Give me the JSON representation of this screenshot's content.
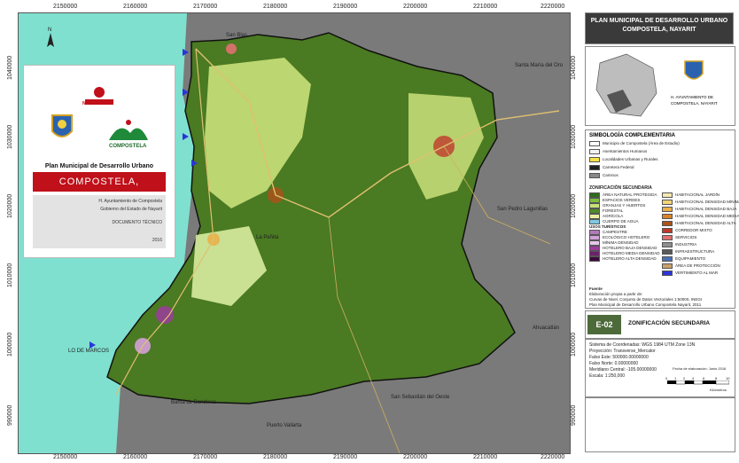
{
  "axes": {
    "top_ticks": [
      "2150000",
      "2160000",
      "2170000",
      "2180000",
      "2190000",
      "2200000",
      "2210000",
      "2220000"
    ],
    "bottom_ticks": [
      "2150000",
      "2160000",
      "2170000",
      "2180000",
      "2190000",
      "2200000",
      "2210000",
      "2220000"
    ],
    "left_ticks": [
      "1040000",
      "1030000",
      "1020000",
      "1010000",
      "1000000",
      "990000"
    ],
    "right_ticks": [
      "1040000",
      "1030000",
      "1020000",
      "1010000",
      "1000000",
      "990000"
    ]
  },
  "places": {
    "san_blas": "San Blas",
    "la_penita": "La Peñita",
    "lo_de_marcos": "LO DE MARCOS",
    "santa_maria": "Santa María del Oro",
    "san_pedro": "San Pedro Lagunillas",
    "san_sebastian": "San Sebastián del Oeste",
    "puerto_vallarta": "Puerto Vallarta",
    "bahia": "Bahía de Banderas",
    "ahuacatlan": "Ahuacatlán"
  },
  "inset": {
    "state": "NAYARIT",
    "municipality_logo": "COMPOSTELA",
    "plan_title": "Plan Municipal de Desarrollo Urbano",
    "town": "COMPOSTELA, NAYARIT.",
    "line1": "H. Ayuntamiento de Compostela",
    "line2": "Gobierno del Estado de Nayarit",
    "line3": "DOCUMENTO TÉCNICO",
    "year": "2016"
  },
  "title_panel": {
    "line1": "PLAN MUNICIPAL DE DESARROLLO URBANO",
    "line2": "COMPOSTELA, NAYARIT"
  },
  "locator": {
    "caption1": "H. AYUNTAMIENTO DE",
    "caption2": "COMPOSTELA, NAYARIT"
  },
  "legend": {
    "title": "SIMBOLOGÍA COMPLEMENTARIA",
    "complementary": [
      {
        "label": "Municipio de Compostela (Área de Estudio)",
        "color": "#ffffff"
      },
      {
        "label": "Asentamientos Humanos",
        "color": "#f2f2f2"
      },
      {
        "label": "Localidades Urbanas y Rurales",
        "color": "#f5e14a"
      },
      {
        "label": "Carretera Federal",
        "color": "#222222"
      },
      {
        "label": "Caminos",
        "color": "#888888"
      }
    ],
    "zoning_title": "ZONIFICACIÓN SECUNDARIA",
    "uses_title": "USOS TURÍSTICOS",
    "zoning": [
      {
        "label": "ÁREA NATURAL PROTEGIDA",
        "color": "#2f6b1f"
      },
      {
        "label": "ESPACIOS VERDES",
        "color": "#7fbf3f"
      },
      {
        "label": "GRANJAS Y HUERTOS",
        "color": "#c8e07a"
      },
      {
        "label": "FORESTAL",
        "color": "#4e8a2a"
      },
      {
        "label": "AGRÍCOLA",
        "color": "#e8f0a0"
      },
      {
        "label": "CUERPO DE AGUA",
        "color": "#7ec8e3"
      },
      {
        "label": "CAMPESTRE",
        "color": "#b07ab8"
      },
      {
        "label": "ECOLÓGICO HOTELERO",
        "color": "#d4a0d8"
      },
      {
        "label": "MÍNIMA DENSIDAD",
        "color": "#e6c6ea"
      },
      {
        "label": "HOTELERO BAJA DENSIDAD",
        "color": "#9b3c9b"
      },
      {
        "label": "HOTELERO MEDIA DENSIDAD",
        "color": "#6d1f6d"
      },
      {
        "label": "HOTELERO ALTA DENSIDAD",
        "color": "#3d0a3d"
      }
    ],
    "zoning_right": [
      {
        "label": "HABITACIONAL JARDÍN",
        "color": "#f6e8b0"
      },
      {
        "label": "HABITACIONAL DENSIDAD MÍNIMA",
        "color": "#f3d37a"
      },
      {
        "label": "HABITACIONAL DENSIDAD BAJA",
        "color": "#eab04a"
      },
      {
        "label": "HABITACIONAL DENSIDAD MEDIA",
        "color": "#d8842a"
      },
      {
        "label": "HABITACIONAL DENSIDAD ALTA",
        "color": "#a8541a"
      },
      {
        "label": "CORREDOR MIXTO",
        "color": "#c0392b"
      },
      {
        "label": "SERVICIOS",
        "color": "#e07070"
      },
      {
        "label": "INDUSTRIA",
        "color": "#8e8e8e"
      },
      {
        "label": "INFRAESTRUCTURA",
        "color": "#5a5a5a"
      },
      {
        "label": "EQUIPAMIENTO",
        "color": "#4a6fb0"
      },
      {
        "label": "ÁREA DE PROTECCIÓN",
        "color": "#c7a26a"
      },
      {
        "label": "VERTIMIENTO AL MAR",
        "color": "#2b35d8"
      }
    ],
    "source_title": "Fuente",
    "source1": "Elaboración propia a partir de:",
    "source2": "Curvas de Nivel, Conjunto de Datos Vectoriales 1:50000, INEGI",
    "source3": "Plan Municipal de Desarrollo Urbano Compostela Nayarit, 2011"
  },
  "plate": {
    "code": "E-02",
    "label": "ZONIFICACIÓN SECUNDARIA"
  },
  "info": {
    "l1": "Sistema de Coordenadas: WGS 1984 UTM Zone 13N",
    "l2": "Proyección: Transverse_Mercator",
    "l3": "Falso Este: 500000.00000000",
    "l4": "Falso Norte: 0.00000000",
    "l5": "Meridiano Central: -105.00000000",
    "l6": "Escala: 1:250,000",
    "date": "Fecha de elaboración: Junio 2016",
    "scale_ticks": [
      "0",
      "1",
      "2",
      "4",
      "6",
      "8",
      "10"
    ],
    "scale_unit": "Kilómetros"
  },
  "colors": {
    "ocean": "#7fe0d0",
    "outside": "#7a7a7a",
    "municipality": "#4a7a22",
    "urban": "#c9e07a",
    "road": "#e0c070"
  }
}
